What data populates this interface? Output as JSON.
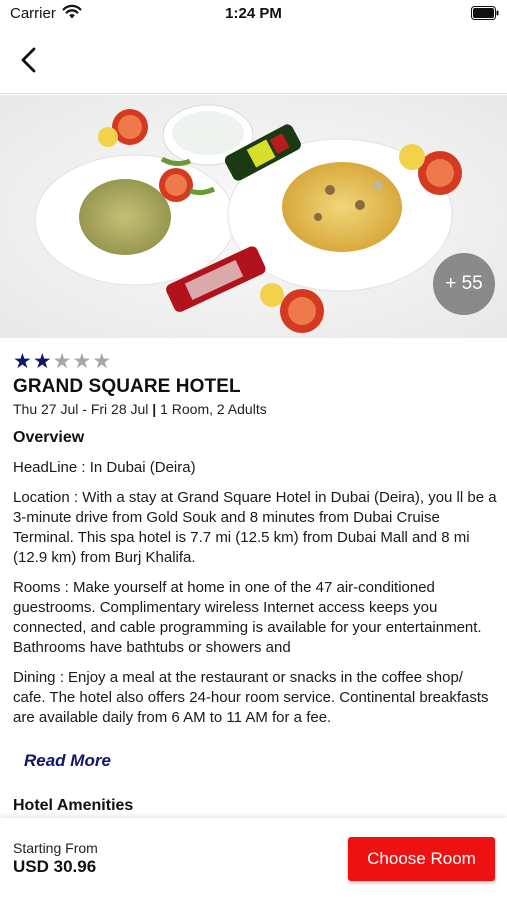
{
  "status_bar": {
    "carrier": "Carrier",
    "time": "1:24 PM",
    "icons": [
      "wifi-icon",
      "battery-icon"
    ]
  },
  "nav": {
    "back_icon": "chevron-left-icon"
  },
  "gallery": {
    "more_photos": "+ 55"
  },
  "hotel": {
    "rating": 2,
    "max_rating": 5,
    "name": "GRAND SQUARE HOTEL",
    "dates": "Thu 27 Jul - Fri 28 Jul",
    "separator": "|",
    "occupancy": "1 Room, 2 Adults"
  },
  "overview": {
    "title": "Overview",
    "headline": "HeadLine : In Dubai (Deira)",
    "location": "Location : With a stay at Grand Square Hotel in Dubai (Deira), you ll be a 3-minute drive from Gold Souk and 8 minutes from Dubai Cruise Terminal. This spa hotel is 7.7 mi (12.5 km) from Dubai Mall and 8 mi (12.9 km) from Burj Khalifa.",
    "rooms": "Rooms : Make yourself at home in one of the 47 air-conditioned guestrooms. Complimentary wireless Internet access keeps you connected, and cable programming is available for your entertainment. Bathrooms have bathtubs or showers and",
    "dining": "Dining : Enjoy a meal at the restaurant or snacks in the coffee shop/ cafe. The hotel also offers 24-hour room service. Continental breakfasts are available daily from 6 AM to 11 AM for a fee.",
    "read_more": "Read More"
  },
  "amenities": {
    "title": "Hotel Amenities"
  },
  "footer": {
    "starting_label": "Starting From",
    "price": "USD 30.96",
    "cta": "Choose Room"
  },
  "colors": {
    "accent_navy": "#10166b",
    "cta_red": "#ee1111",
    "star_empty": "#a7a7a7"
  }
}
